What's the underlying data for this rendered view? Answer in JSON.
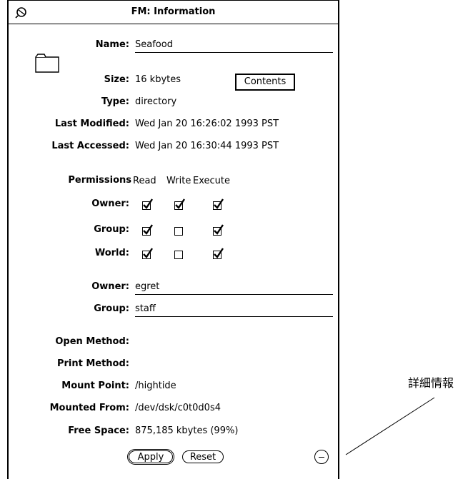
{
  "window": {
    "title": "FM: Information",
    "menu_icon": "window-menu-icon"
  },
  "file": {
    "icon": "folder-icon",
    "name_label": "Name:",
    "name_value": "Seafood",
    "size_label": "Size:",
    "size_value": "16 kbytes",
    "type_label": "Type:",
    "type_value": "directory",
    "modified_label": "Last Modified:",
    "modified_value": "Wed Jan 20 16:26:02 1993 PST",
    "accessed_label": "Last Accessed:",
    "accessed_value": "Wed Jan 20 16:30:44 1993 PST",
    "contents_button": "Contents"
  },
  "permissions": {
    "label": "Permissions",
    "columns": [
      "Read",
      "Write",
      "Execute"
    ],
    "rows": [
      {
        "label": "Owner:",
        "checks": [
          true,
          true,
          true
        ]
      },
      {
        "label": "Group:",
        "checks": [
          true,
          false,
          true
        ]
      },
      {
        "label": "World:",
        "checks": [
          true,
          false,
          true
        ]
      }
    ]
  },
  "ownership": {
    "owner_label": "Owner:",
    "owner_value": "egret",
    "group_label": "Group:",
    "group_value": "staff"
  },
  "methods": {
    "open_label": "Open Method:",
    "open_value": "",
    "print_label": "Print Method:",
    "print_value": "",
    "mount_point_label": "Mount Point:",
    "mount_point_value": "/hightide",
    "mounted_from_label": "Mounted From:",
    "mounted_from_value": "/dev/dsk/c0t0d0s4",
    "free_space_label": "Free Space:",
    "free_space_value": "875,185 kbytes (99%)"
  },
  "buttons": {
    "apply": "Apply",
    "reset": "Reset",
    "more_icon": "more-details-icon"
  },
  "annotation": {
    "callout": "詳細情報"
  }
}
